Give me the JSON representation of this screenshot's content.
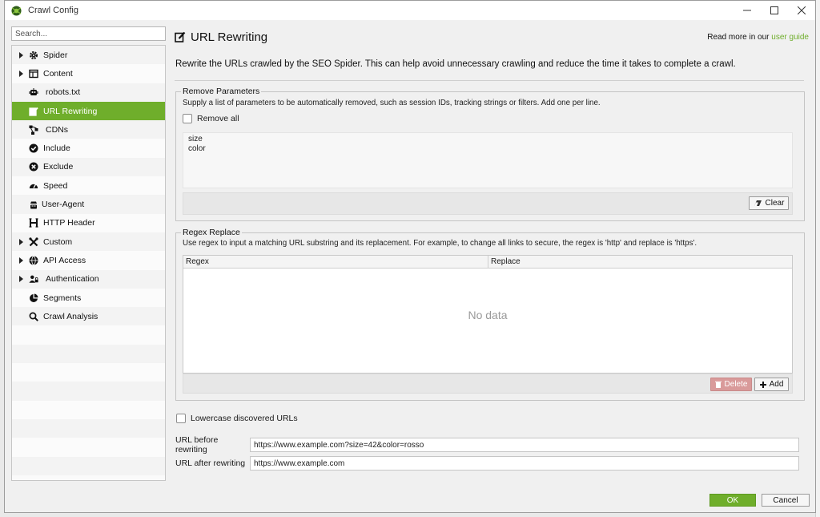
{
  "window": {
    "title": "Crawl Config"
  },
  "sidebar": {
    "search_placeholder": "Search...",
    "items": [
      {
        "label": "Spider",
        "icon": "gear-icon",
        "expandable": true,
        "selected": false
      },
      {
        "label": "Content",
        "icon": "content-icon",
        "expandable": true,
        "selected": false
      },
      {
        "label": "robots.txt",
        "icon": "robot-icon",
        "expandable": false,
        "selected": false
      },
      {
        "label": "URL Rewriting",
        "icon": "edit-icon",
        "expandable": false,
        "selected": true
      },
      {
        "label": "CDNs",
        "icon": "cdn-icon",
        "expandable": false,
        "selected": false
      },
      {
        "label": "Include",
        "icon": "check-circle-icon",
        "expandable": false,
        "selected": false
      },
      {
        "label": "Exclude",
        "icon": "x-circle-icon",
        "expandable": false,
        "selected": false
      },
      {
        "label": "Speed",
        "icon": "speed-icon",
        "expandable": false,
        "selected": false
      },
      {
        "label": "User-Agent",
        "icon": "user-agent-icon",
        "expandable": false,
        "selected": false
      },
      {
        "label": "HTTP Header",
        "icon": "header-icon",
        "expandable": false,
        "selected": false
      },
      {
        "label": "Custom",
        "icon": "tools-icon",
        "expandable": true,
        "selected": false
      },
      {
        "label": "API Access",
        "icon": "globe-icon",
        "expandable": true,
        "selected": false
      },
      {
        "label": "Authentication",
        "icon": "users-icon",
        "expandable": true,
        "selected": false
      },
      {
        "label": "Segments",
        "icon": "pie-icon",
        "expandable": false,
        "selected": false
      },
      {
        "label": "Crawl Analysis",
        "icon": "magnifier-icon",
        "expandable": false,
        "selected": false
      }
    ]
  },
  "main": {
    "title": "URL Rewriting",
    "read_more_prefix": "Read more in our ",
    "read_more_link": "user guide",
    "description": "Rewrite the URLs crawled by the SEO Spider. This can help avoid unnecessary crawling and reduce the time it takes to complete a crawl.",
    "remove_params": {
      "legend": "Remove Parameters",
      "help": "Supply a list of parameters to be automatically removed, such as session IDs, tracking strings or filters. Add one per line.",
      "remove_all_label": "Remove all",
      "remove_all_checked": false,
      "params": [
        "size",
        "color"
      ],
      "clear_label": "Clear"
    },
    "regex_replace": {
      "legend": "Regex Replace",
      "help": "Use regex to input a matching URL substring and its replacement. For example, to change all links to secure, the regex is 'http' and replace is 'https'.",
      "columns": [
        "Regex",
        "Replace"
      ],
      "empty_text": "No data",
      "delete_label": "Delete",
      "add_label": "Add"
    },
    "lowercase_label": "Lowercase discovered URLs",
    "lowercase_checked": false,
    "url_before_label": "URL before rewriting",
    "url_before_value": "https://www.example.com?size=42&color=rosso",
    "url_after_label": "URL after rewriting",
    "url_after_value": "https://www.example.com"
  },
  "footer": {
    "ok_label": "OK",
    "cancel_label": "Cancel"
  },
  "colors": {
    "accent": "#6fae2b",
    "delete_button": "#d99a9a"
  }
}
